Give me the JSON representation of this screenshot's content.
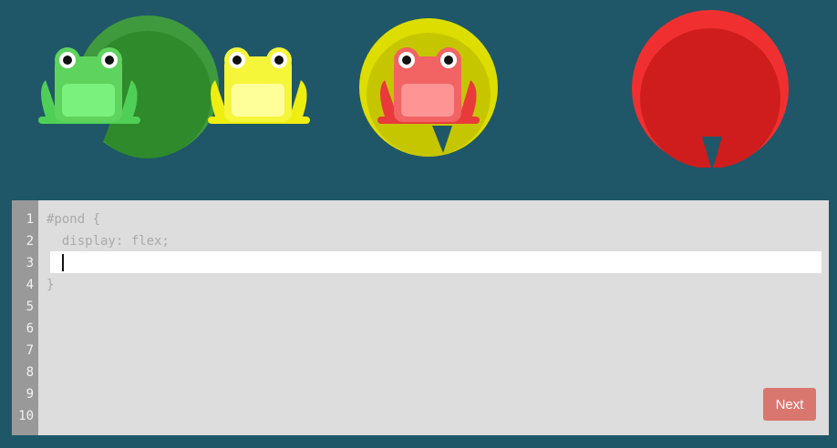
{
  "editor": {
    "line_numbers": [
      "1",
      "2",
      "3",
      "4",
      "5",
      "6",
      "7",
      "8",
      "9",
      "10"
    ],
    "code_lines": [
      "#pond {",
      "  display: flex;",
      "",
      "}"
    ],
    "input_value": "",
    "next_label": "Next"
  },
  "pond": {
    "frogs": [
      {
        "color": "green",
        "icon": "frog-icon"
      },
      {
        "color": "yellow",
        "icon": "frog-icon"
      },
      {
        "color": "red",
        "icon": "frog-icon"
      }
    ],
    "lilypads": [
      {
        "color": "green",
        "icon": "lilypad-icon"
      },
      {
        "color": "yellow",
        "icon": "lilypad-icon"
      },
      {
        "color": "red",
        "icon": "lilypad-icon"
      }
    ]
  },
  "colors": {
    "background": "#1f5768",
    "editor_bg": "#dddddd",
    "gutter_bg": "#999999",
    "next_button": "#d9776e"
  }
}
